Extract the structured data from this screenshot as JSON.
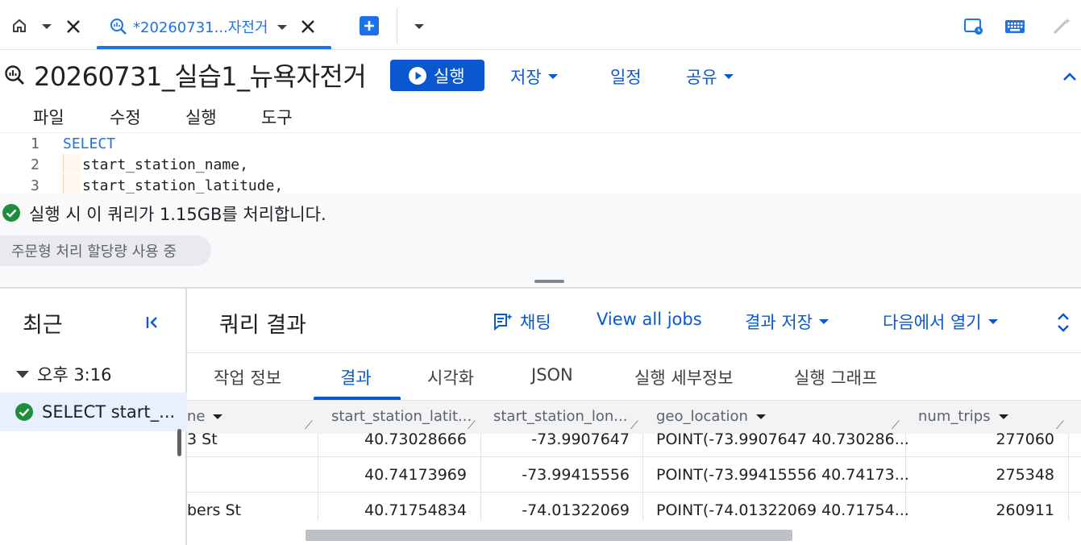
{
  "tabs": {
    "query_tab_label": "*20260731...자전거"
  },
  "header": {
    "title": "20260731_실습1_뉴욕자전거",
    "run_label": "실행",
    "save_label": "저장",
    "schedule_label": "일정",
    "share_label": "공유"
  },
  "menu": {
    "file": "파일",
    "edit": "수정",
    "run": "실행",
    "tools": "도구"
  },
  "editor": {
    "lines": [
      {
        "num": "1",
        "text": "SELECT"
      },
      {
        "num": "2",
        "text": "start_station_name,"
      },
      {
        "num": "3",
        "text": "start_station_latitude,"
      }
    ]
  },
  "status": {
    "message": "실행 시 이 쿼리가 1.15GB를 처리합니다.",
    "pill": "주문형 처리 할당량 사용 중"
  },
  "recent": {
    "title": "최근",
    "group": "오후 3:16",
    "job": "SELECT   start_..."
  },
  "results": {
    "title": "쿼리 결과",
    "chat": "채팅",
    "view_all_jobs": "View all jobs",
    "save_results": "결과 저장",
    "open_in": "다음에서 열기",
    "subtabs": [
      "작업 정보",
      "결과",
      "시각화",
      "JSON",
      "실행 세부정보",
      "실행 그래프"
    ],
    "columns": [
      "ne",
      "start_station_latit...",
      "start_station_lon...",
      "geo_location",
      "num_trips"
    ],
    "rows": [
      [
        "3 St",
        "40.73028666",
        "-73.9907647",
        "POINT(-73.9907647 40.730286...",
        "277060"
      ],
      [
        "",
        "40.74173969",
        "-73.99415556",
        "POINT(-73.99415556 40.74173...",
        "275348"
      ],
      [
        "bers St",
        "40.71754834",
        "-74.01322069",
        "POINT(-74.01322069 40.71754...",
        "260911"
      ]
    ]
  },
  "colors": {
    "accent": "#0b57d0",
    "success": "#1e8e3e"
  }
}
